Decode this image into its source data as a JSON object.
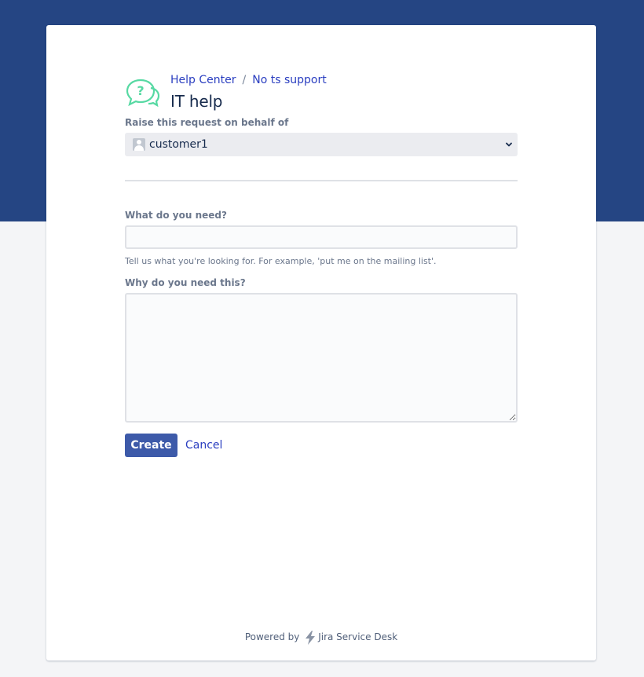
{
  "breadcrumb": {
    "help_center": "Help Center",
    "separator": "/",
    "project": "No ts support"
  },
  "page_title": "IT help",
  "on_behalf": {
    "label": "Raise this request on behalf of",
    "value": "customer1"
  },
  "fields": {
    "summary": {
      "label": "What do you need?",
      "value": "",
      "placeholder": "",
      "helper": "Tell us what you're looking for. For example, 'put me on the mailing list'."
    },
    "description": {
      "label": "Why do you need this?",
      "value": "",
      "placeholder": ""
    }
  },
  "actions": {
    "create": "Create",
    "cancel": "Cancel"
  },
  "footer": {
    "powered_by": "Powered by",
    "product": "Jira Service Desk"
  },
  "colors": {
    "brand_band": "#254583",
    "primary_button": "#3d5aa9",
    "link": "#2a3ec0",
    "portal_icon": "#57d9a3"
  },
  "icons": [
    "help-chat-icon",
    "user-avatar-icon",
    "chevron-down-icon",
    "jira-bolt-icon"
  ]
}
